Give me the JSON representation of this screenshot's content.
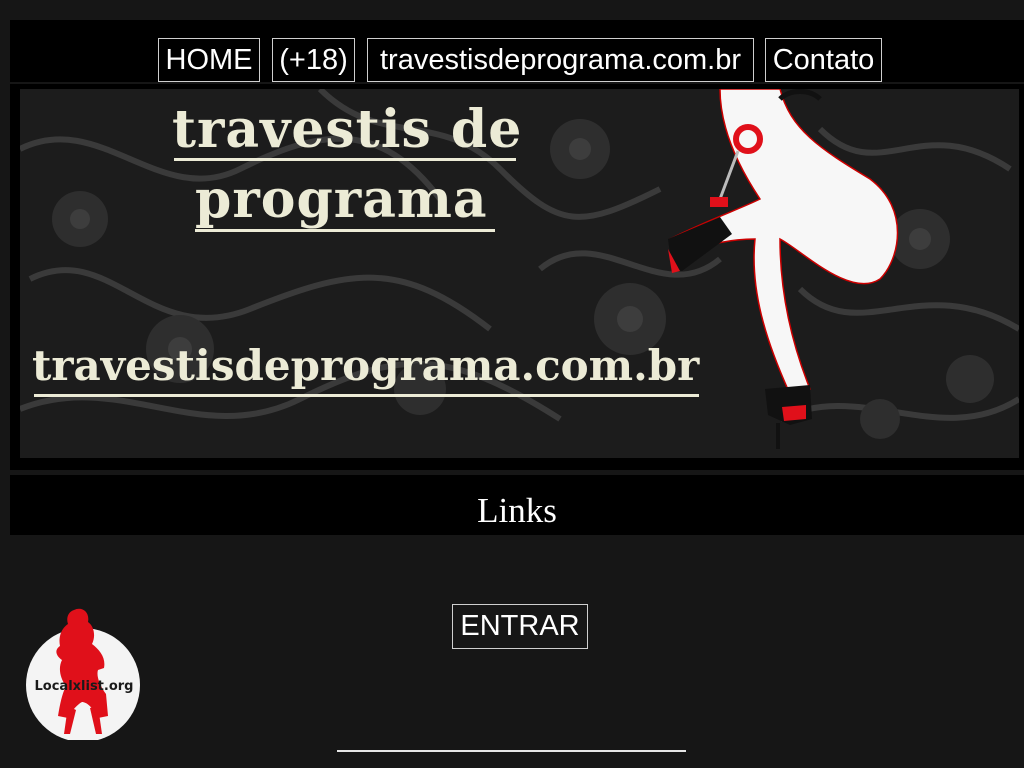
{
  "nav": {
    "home": "HOME",
    "adult": "(+18)",
    "site": "travestisdeprograma.com.br",
    "contact": "Contato"
  },
  "banner": {
    "title_line1": "travestis de",
    "title_line2": "programa",
    "domain": "travestisdeprograma.com.br"
  },
  "links": {
    "heading": "Links"
  },
  "enter_button": "ENTRAR",
  "badge": {
    "label": "Localxlist.org"
  },
  "colors": {
    "page_bg": "#161616",
    "bar_bg": "#000000",
    "banner_text": "#ecebd6",
    "accent_red": "#e0101a",
    "text": "#ffffff"
  }
}
